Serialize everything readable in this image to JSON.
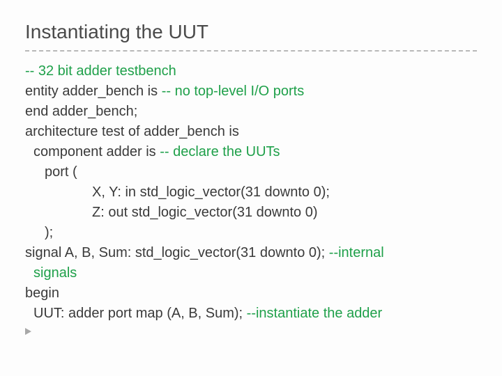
{
  "title": "Instantiating the UUT",
  "lines": {
    "l1a": "-- 32 bit adder testbench",
    "l2a": "entity adder_bench is ",
    "l2b": "-- no top-level I/O ports",
    "l3": "end adder_bench;",
    "l4": "architecture test of adder_bench is",
    "l5a": "component adder is   ",
    "l5b": "-- declare the UUTs",
    "l6": "port (",
    "l7": "X, Y: in std_logic_vector(31 downto 0);",
    "l8": "Z: out std_logic_vector(31 downto 0)",
    "l9": ");",
    "l10a": "signal A, B, Sum: std_logic_vector(31 downto 0);  ",
    "l10b": "--internal",
    "l11": "signals",
    "l12": "begin",
    "l13a": "UUT: adder port map (A, B, Sum);  ",
    "l13b": "--instantiate the adder"
  }
}
